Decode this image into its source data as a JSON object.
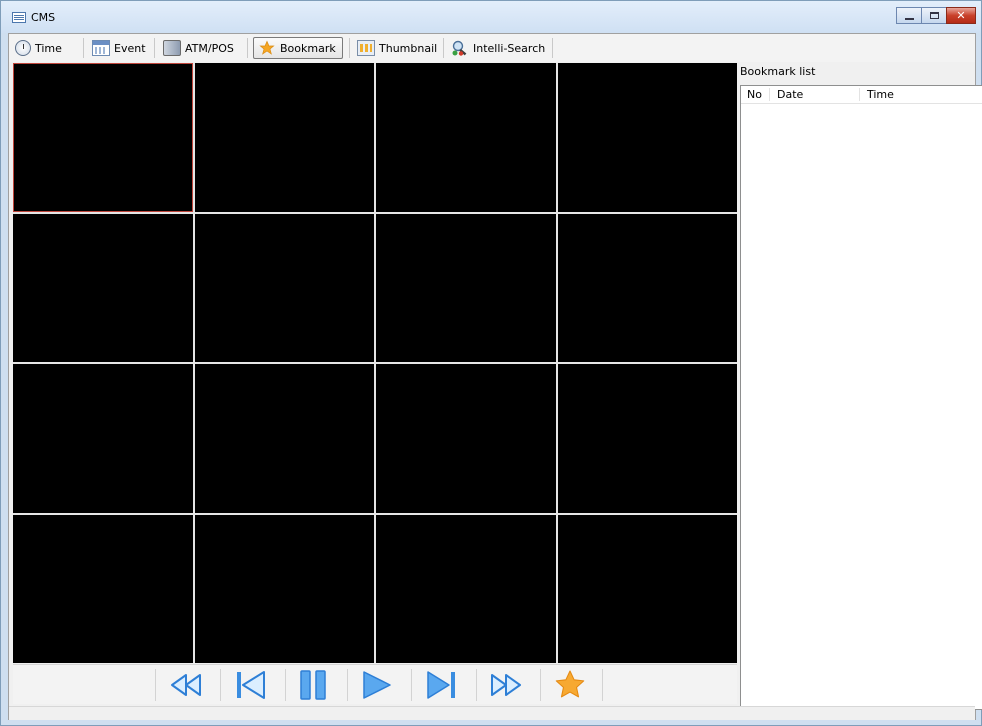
{
  "window": {
    "title": "CMS",
    "controls": [
      "minimize",
      "maximize",
      "close"
    ],
    "close_glyph": "✕"
  },
  "toolbar": {
    "items": [
      {
        "label": "Time",
        "icon": "clock-icon",
        "active": false
      },
      {
        "label": "Event",
        "icon": "calendar-icon",
        "active": false
      },
      {
        "label": "ATM/POS",
        "icon": "atm-icon",
        "active": false
      },
      {
        "label": "Bookmark",
        "icon": "star-icon",
        "active": true
      },
      {
        "label": "Thumbnail",
        "icon": "thumbnail-icon",
        "active": false
      },
      {
        "label": "Intelli-Search",
        "icon": "search-people-icon",
        "active": false
      }
    ]
  },
  "video_grid": {
    "rows": 4,
    "columns": 4,
    "selected_cell": 1
  },
  "playback": {
    "buttons": [
      "fast-rewind",
      "previous-frame",
      "pause",
      "play",
      "next-frame",
      "fast-forward",
      "add-bookmark"
    ]
  },
  "bookmark_panel": {
    "title": "Bookmark list",
    "columns": [
      "No",
      "Date",
      "Time"
    ],
    "rows": []
  },
  "colors": {
    "accent_blue": "#3a8de0",
    "star": "#f5a623",
    "selected_cell_border": "#c0463c"
  }
}
